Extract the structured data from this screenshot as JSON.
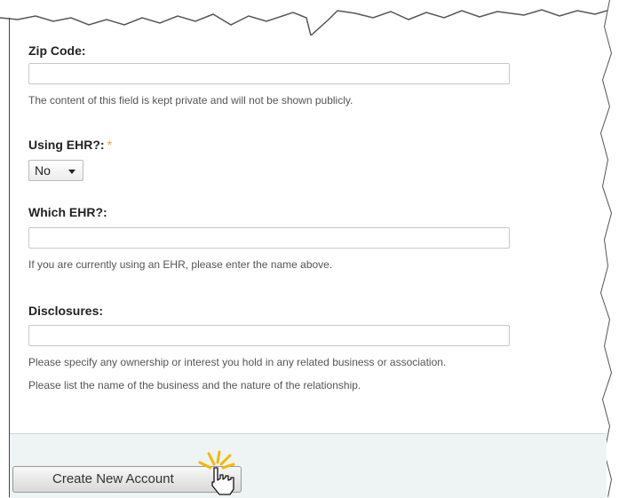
{
  "fields": {
    "zip": {
      "label": "Zip Code:",
      "value": "",
      "help": "The content of this field is kept private and will not be shown publicly."
    },
    "ehr": {
      "label": "Using EHR?:",
      "required_mark": "*",
      "selected": "No"
    },
    "which_ehr": {
      "label": "Which EHR?:",
      "value": "",
      "help": "If you are currently using an EHR, please enter the name above."
    },
    "disclosures": {
      "label": "Disclosures:",
      "value": "",
      "help_line1": "Please specify any ownership or interest you hold in any related business or association.",
      "help_line2": "Please list the name of the business and the nature of the relationship."
    }
  },
  "footer": {
    "submit_label": "Create New Account"
  },
  "colors": {
    "required": "#f0a030",
    "footer_bg": "#eef4f4"
  }
}
